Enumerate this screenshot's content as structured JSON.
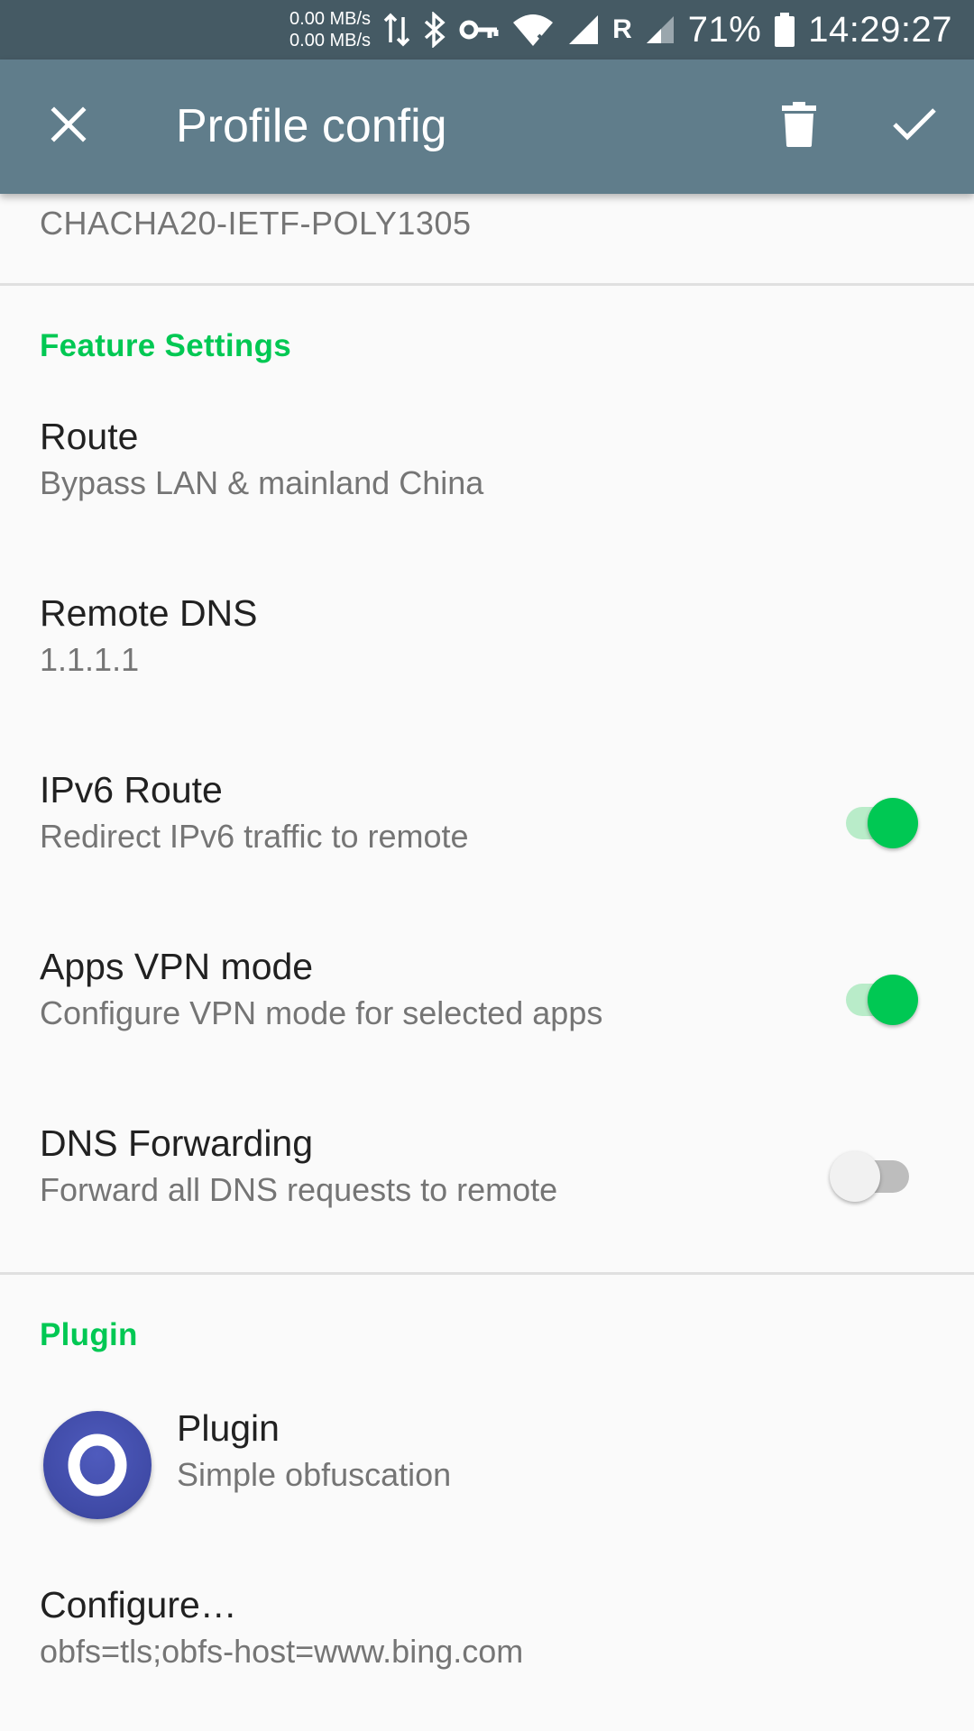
{
  "status_bar": {
    "speed_up": "0.00 MB/s",
    "speed_down": "0.00 MB/s",
    "carrier_letter": "R",
    "battery": "71%",
    "time": "14:29:27"
  },
  "toolbar": {
    "title": "Profile config",
    "background_color": "#607d8b"
  },
  "previous_section": {
    "value": "CHACHA20-IETF-POLY1305"
  },
  "feature_settings": {
    "header": "Feature Settings",
    "items": [
      {
        "title": "Route",
        "summary": "Bypass LAN & mainland China"
      },
      {
        "title": "Remote DNS",
        "summary": "1.1.1.1"
      },
      {
        "title": "IPv6 Route",
        "summary": "Redirect IPv6 traffic to remote",
        "enabled": true
      },
      {
        "title": "Apps VPN mode",
        "summary": "Configure VPN mode for selected apps",
        "enabled": true
      },
      {
        "title": "DNS Forwarding",
        "summary": "Forward all DNS requests to remote",
        "enabled": false
      }
    ]
  },
  "plugin_section": {
    "header": "Plugin",
    "plugin": {
      "title": "Plugin",
      "summary": "Simple obfuscation",
      "icon_letter": "O"
    },
    "configure": {
      "title": "Configure…",
      "summary": "obfs=tls;obfs-host=www.bing.com"
    }
  },
  "colors": {
    "accent": "#00c853",
    "status_bar": "#455a64"
  }
}
